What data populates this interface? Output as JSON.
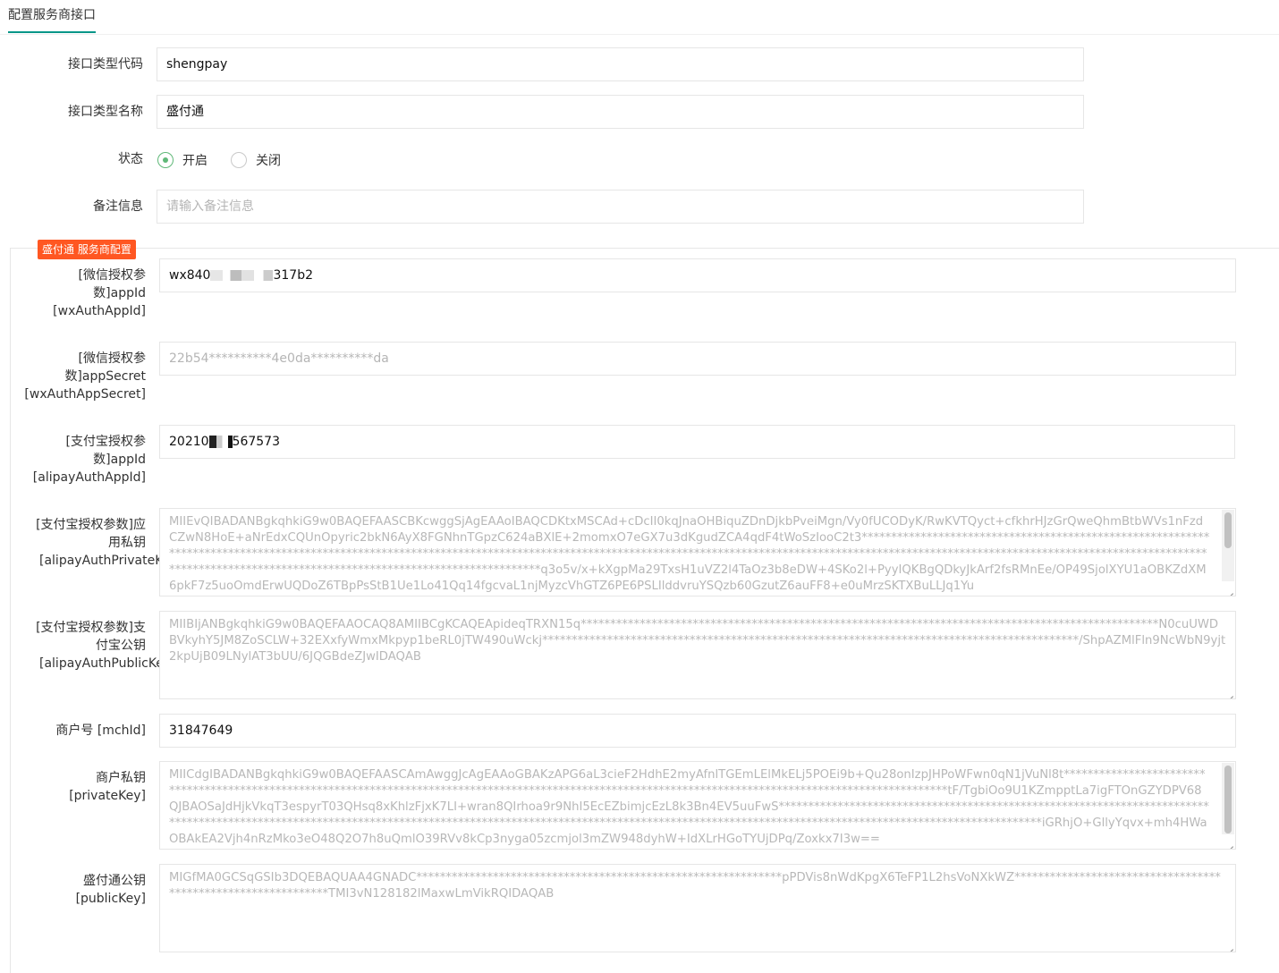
{
  "tab": {
    "title": "配置服务商接口"
  },
  "basic": {
    "type_code": {
      "label": "接口类型代码",
      "value": "shengpay"
    },
    "type_name": {
      "label": "接口类型名称",
      "value": "盛付通"
    },
    "status": {
      "label": "状态",
      "options": [
        "开启",
        "关闭"
      ],
      "selected": "开启"
    },
    "remark": {
      "label": "备注信息",
      "placeholder": "请输入备注信息",
      "value": ""
    }
  },
  "section": {
    "legend": "盛付通 服务商配置"
  },
  "fields": {
    "wx_appid": {
      "label_l1": "[微信授权参",
      "label_l2": "数]appId",
      "label_l3": "[wxAuthAppId]",
      "value_a": "wx840",
      "value_b": "317b2"
    },
    "wx_secret": {
      "label_l1": "[微信授权参",
      "label_l2": "数]appSecret",
      "label_l3": "[wxAuthAppSecret]",
      "placeholder": "22b54**********4e0da**********da"
    },
    "ali_appid": {
      "label_l1": "[支付宝授权参",
      "label_l2": "数]appId",
      "label_l3": "[alipayAuthAppId]",
      "value_a": "20210",
      "value_b": "567573"
    },
    "ali_private_key": {
      "label_l1": "[支付宝授权参数]应",
      "label_l2": "用私钥",
      "label_l3": "[alipayAuthPrivateKey]",
      "placeholder": "MIIEvQIBADANBgkqhkiG9w0BAQEFAASCBKcwggSjAgEAAoIBAQCDKtxMSCAd+cDcII0kqJnaOHBiquZDnDjkbPveiMgn/Vy0fUCODyK/RwKVTQyct+cfkhrHJzGrQweQhmBtbWVs1nFzdCZwN8HoE+aNrEdxCQUnOpyric2bkN6AyX8FGNhnTGpzC624aBXlE+2momxO7eGX7u3dKgudZCA4qdF4tWoSzIooC2t3**********************************************************************************************************************************************************************************************************************************************************************************************************q3o5v/x+kXgpMa29TxsH1uVZ2l4TaOz3b8eDW+4SKo2l+PyyIQKBgQDkyJkArf2fsRMnEe/OP49SjolXYU1aOBKZdXM6pkF7z5uoOmdErwUQDoZ6TBpPsStB1Ue1Lo41Qq14fgcvaL1njMyzcVhGTZ6PE6PSLIlddvruYSQzb60GzutZ6auFF8+e0uMrzSKTXBuLLJq1Yu"
    },
    "ali_public_key": {
      "label_l1": "[支付宝授权参数]支",
      "label_l2": "付宝公钥",
      "label_l3": "[alipayAuthPublicKey]",
      "placeholder": "MIIBIjANBgkqhkiG9w0BAQEFAAOCAQ8AMIIBCgKCAQEApideqTRXN15q**************************************************************************************************N0cuUWDBVkyhY5JM8ZoSCLW+32EXxfyWmxMkpyp1beRL0jTW490uWckj*******************************************************************************************/ShpAZMlFln9NcWbN9yjt2kpUjB09LNylAT3bUU/6JQGBdeZJwIDAQAB"
    },
    "mch_id": {
      "label": "商户号 [mchId]",
      "value": "31847649"
    },
    "private_key": {
      "label_l1": "商户私钥",
      "label_l2": "[privateKey]",
      "placeholder": "MIICdgIBADANBgkqhkiG9w0BAQEFAASCAmAwggJcAgEAAoGBAKzAPG6aL3cieF2HdhE2myAfnlTGEmLElMkELj5POEi9b+Qu28onIzpJHPoWFwn0qN1jVuNl8t************************************************************************************************************************************************************tF/TgbiOo9U1KZmpptLa7igFTOnGZYDPV68QJBAOSaJdHjkVkqT3espyrT03QHsq8xKhlzFjxK7LI+wran8QIrhoa9r9NhI5EcEZbimjcEzL8k3Bn4EV5uuFwS*****************************************************************************************************************************************************************************************************************************iGRhjO+GllyYqvx+mh4HWaOBAkEA2Vjh4nRzMko3eO48Q2O7h8uQmlO39RVv8kCp3nyga05zcmjol3mZW948dyhW+IdXLrHGoTYUjDPq/Zoxkx7I3w=="
    },
    "public_key": {
      "label_l1": "盛付通公钥",
      "label_l2": "[publicKey]",
      "placeholder": "MIGfMA0GCSqGSIb3DQEBAQUAA4GNADC**************************************************************pPDVis8nWdKpgX6TeFP1L2hsVoNXkWZ**************************************************************TMI3vN128182lMaxwLmVikRQIDAQAB"
    }
  }
}
